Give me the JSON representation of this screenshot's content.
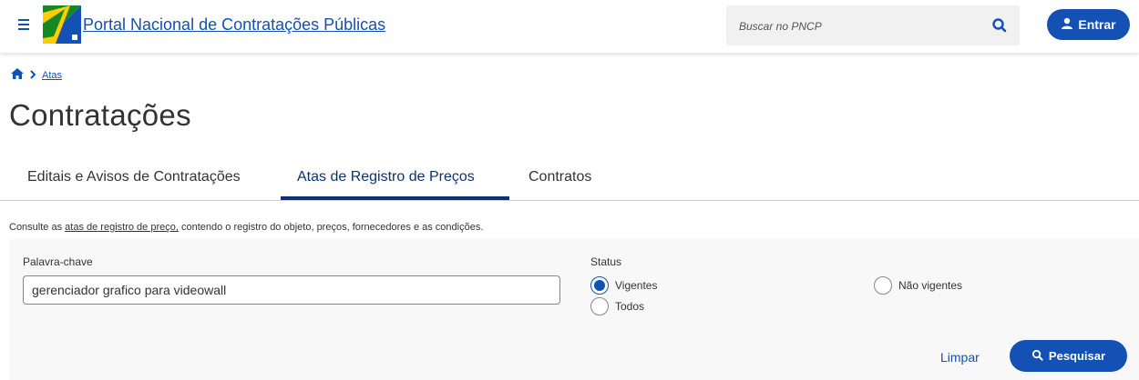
{
  "header": {
    "menu_icon": "hamburger-menu-icon",
    "logo_icon": "gov-br-logo",
    "site_title": "Portal Nacional de Contratações Públicas",
    "search": {
      "placeholder": "Buscar no PNCP",
      "icon": "search-icon"
    },
    "login_button": {
      "label": "Entrar",
      "icon": "user-icon"
    }
  },
  "breadcrumb": {
    "home_icon": "home-icon",
    "separator_icon": "chevron-right-icon",
    "items": [
      "Atas"
    ]
  },
  "page_title": "Contratações",
  "tabs": [
    {
      "label": "Editais e Avisos de Contratações",
      "active": false
    },
    {
      "label": "Atas de Registro de Preços",
      "active": true
    },
    {
      "label": "Contratos",
      "active": false
    }
  ],
  "description": {
    "prefix": "Consulte as ",
    "link": "atas de registro de preço,",
    "suffix": " contendo o registro do objeto, preços, fornecedores e as condições."
  },
  "filters": {
    "keyword_label": "Palavra-chave",
    "keyword_value": "gerenciador grafico para videowall",
    "status_label": "Status",
    "status_options": [
      {
        "label": "Vigentes",
        "checked": true
      },
      {
        "label": "Não vigentes",
        "checked": false
      },
      {
        "label": "Todos",
        "checked": false
      }
    ],
    "clear_label": "Limpar",
    "search_label": "Pesquisar"
  },
  "colors": {
    "primary": "#1351b4",
    "tab_active": "#0c326f",
    "panel_bg": "#f8f8f8"
  }
}
